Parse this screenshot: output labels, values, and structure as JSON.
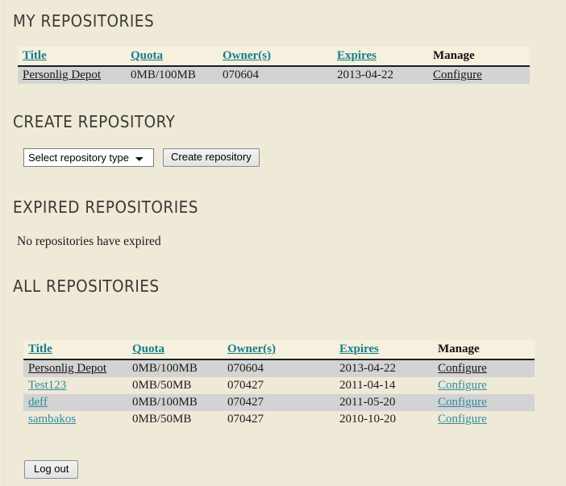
{
  "sections": {
    "my_repositories_heading": "MY REPOSITORIES",
    "create_repository_heading": "CREATE REPOSITORY",
    "expired_repositories_heading": "EXPIRED REPOSITORIES",
    "all_repositories_heading": "ALL REPOSITORIES"
  },
  "table_headers": {
    "title": "Title",
    "quota": "Quota",
    "owners": "Owner(s)",
    "expires": "Expires",
    "manage": "Manage"
  },
  "my_repositories": {
    "rows": [
      {
        "title": "Personlig Depot",
        "quota": "0MB/100MB",
        "owners": "070604",
        "expires": "2013-04-22",
        "manage": "Configure",
        "title_style": "visited",
        "manage_style": "visited"
      }
    ]
  },
  "create_repository": {
    "select_value": "Select repository type",
    "select_options": [
      "Select repository type"
    ],
    "button_label": "Create repository"
  },
  "expired_repositories": {
    "empty_message": "No repositories have expired"
  },
  "all_repositories": {
    "rows": [
      {
        "title": "Personlig Depot",
        "quota": "0MB/100MB",
        "owners": "070604",
        "expires": "2013-04-22",
        "manage": "Configure",
        "title_style": "visited",
        "manage_style": "visited"
      },
      {
        "title": "Test123",
        "quota": "0MB/50MB",
        "owners": "070427",
        "expires": "2011-04-14",
        "manage": "Configure",
        "title_style": "link",
        "manage_style": "link"
      },
      {
        "title": "deff",
        "quota": "0MB/100MB",
        "owners": "070427",
        "expires": "2011-05-20",
        "manage": "Configure",
        "title_style": "link",
        "manage_style": "link"
      },
      {
        "title": "sambakos",
        "quota": "0MB/50MB",
        "owners": "070427",
        "expires": "2010-10-20",
        "manage": "Configure",
        "title_style": "link",
        "manage_style": "link"
      }
    ]
  },
  "footer": {
    "logout_label": "Log out"
  },
  "colors": {
    "page_background": "#efe9d8",
    "header_row_background": "#f6f0de",
    "row_stripe_background": "#d3d3d3",
    "link_teal": "#2f8e9e",
    "header_link_teal": "#157d8c",
    "heading_text": "#3a3935"
  }
}
